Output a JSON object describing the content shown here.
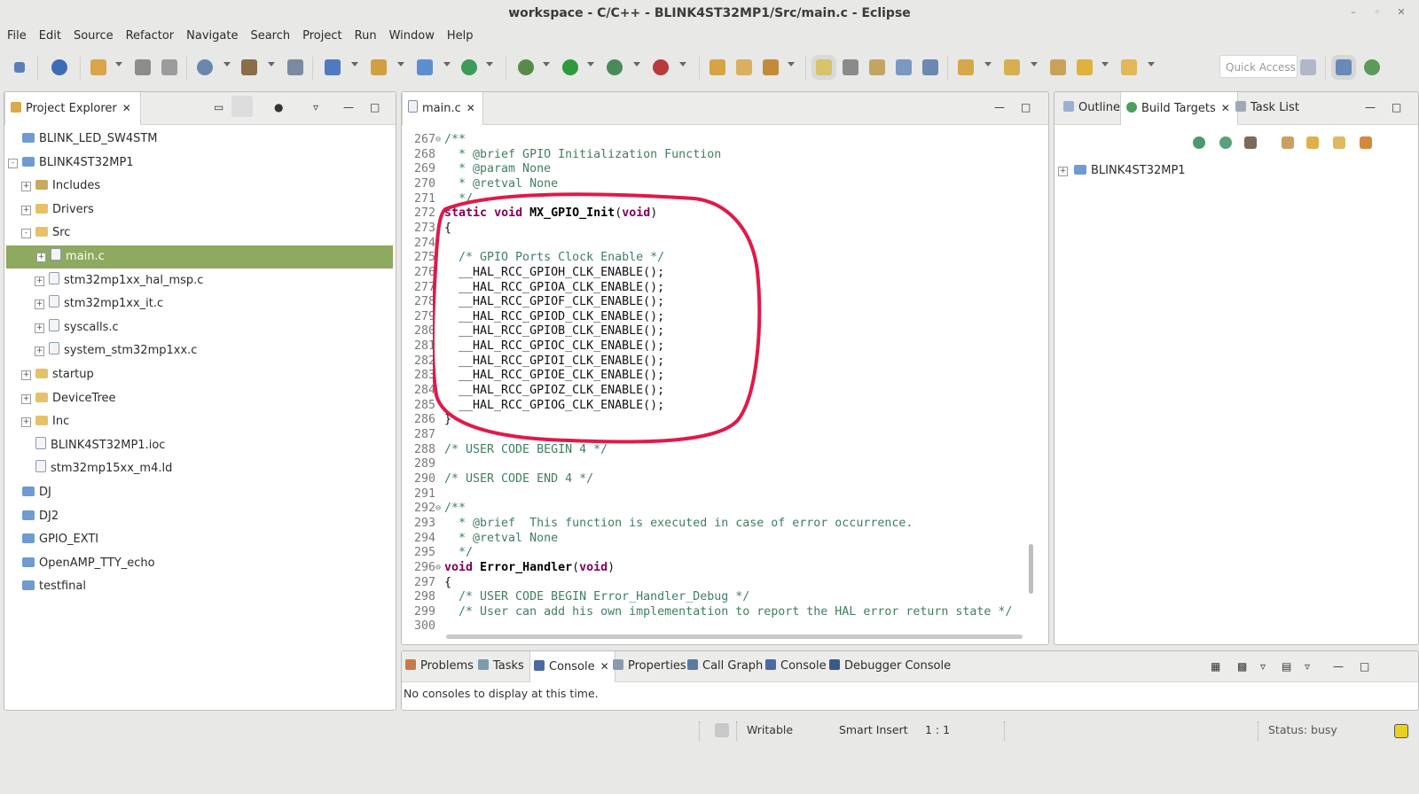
{
  "window": {
    "title": "workspace - C/C++ - BLINK4ST32MP1/Src/main.c - Eclipse"
  },
  "menu": [
    "File",
    "Edit",
    "Source",
    "Refactor",
    "Navigate",
    "Search",
    "Project",
    "Run",
    "Window",
    "Help"
  ],
  "toolbar": {
    "quick_access_placeholder": "Quick Access"
  },
  "project_explorer": {
    "tab": "Project Explorer",
    "items": [
      {
        "label": "BLINK_LED_SW4STM",
        "icon": "project-folder-icon"
      },
      {
        "label": "BLINK4ST32MP1",
        "icon": "project-folder-icon"
      },
      {
        "label": "Includes",
        "icon": "includes-icon"
      },
      {
        "label": "Drivers",
        "icon": "folder-icon"
      },
      {
        "label": "Src",
        "icon": "folder-icon"
      },
      {
        "label": "main.c",
        "icon": "c-file-icon"
      },
      {
        "label": "stm32mp1xx_hal_msp.c",
        "icon": "c-file-icon"
      },
      {
        "label": "stm32mp1xx_it.c",
        "icon": "c-file-icon"
      },
      {
        "label": "syscalls.c",
        "icon": "c-file-icon"
      },
      {
        "label": "system_stm32mp1xx.c",
        "icon": "c-file-icon"
      },
      {
        "label": "startup",
        "icon": "folder-icon"
      },
      {
        "label": "DeviceTree",
        "icon": "folder-icon"
      },
      {
        "label": "Inc",
        "icon": "folder-icon"
      },
      {
        "label": "BLINK4ST32MP1.ioc",
        "icon": "file-icon"
      },
      {
        "label": "stm32mp15xx_m4.ld",
        "icon": "file-icon"
      },
      {
        "label": "DJ",
        "icon": "project-folder-icon"
      },
      {
        "label": "DJ2",
        "icon": "project-folder-icon"
      },
      {
        "label": "GPIO_EXTI",
        "icon": "project-folder-icon"
      },
      {
        "label": "OpenAMP_TTY_echo",
        "icon": "project-folder-icon"
      },
      {
        "label": "testfinal",
        "icon": "project-folder-icon"
      }
    ]
  },
  "editor": {
    "tab": "main.c",
    "lines": [
      {
        "n": "267",
        "t": "/**"
      },
      {
        "n": "268",
        "t": "  * @brief GPIO Initialization Function"
      },
      {
        "n": "269",
        "t": "  * @param None"
      },
      {
        "n": "270",
        "t": "  * @retval None"
      },
      {
        "n": "271",
        "t": "  */"
      },
      {
        "n": "272",
        "t": "static void MX_GPIO_Init(void)"
      },
      {
        "n": "273",
        "t": "{"
      },
      {
        "n": "274",
        "t": ""
      },
      {
        "n": "275",
        "t": "  /* GPIO Ports Clock Enable */"
      },
      {
        "n": "276",
        "t": "  __HAL_RCC_GPIOH_CLK_ENABLE();"
      },
      {
        "n": "277",
        "t": "  __HAL_RCC_GPIOA_CLK_ENABLE();"
      },
      {
        "n": "278",
        "t": "  __HAL_RCC_GPIOF_CLK_ENABLE();"
      },
      {
        "n": "279",
        "t": "  __HAL_RCC_GPIOD_CLK_ENABLE();"
      },
      {
        "n": "280",
        "t": "  __HAL_RCC_GPIOB_CLK_ENABLE();"
      },
      {
        "n": "281",
        "t": "  __HAL_RCC_GPIOC_CLK_ENABLE();"
      },
      {
        "n": "282",
        "t": "  __HAL_RCC_GPIOI_CLK_ENABLE();"
      },
      {
        "n": "283",
        "t": "  __HAL_RCC_GPIOE_CLK_ENABLE();"
      },
      {
        "n": "284",
        "t": "  __HAL_RCC_GPIOZ_CLK_ENABLE();"
      },
      {
        "n": "285",
        "t": "  __HAL_RCC_GPIOG_CLK_ENABLE();"
      },
      {
        "n": "286",
        "t": "}"
      },
      {
        "n": "287",
        "t": ""
      },
      {
        "n": "288",
        "t": "/* USER CODE BEGIN 4 */"
      },
      {
        "n": "289",
        "t": ""
      },
      {
        "n": "290",
        "t": "/* USER CODE END 4 */"
      },
      {
        "n": "291",
        "t": ""
      },
      {
        "n": "292",
        "t": "/**"
      },
      {
        "n": "293",
        "t": "  * @brief  This function is executed in case of error occurrence."
      },
      {
        "n": "294",
        "t": "  * @retval None"
      },
      {
        "n": "295",
        "t": "  */"
      },
      {
        "n": "296",
        "t": "void Error_Handler(void)"
      },
      {
        "n": "297",
        "t": "{"
      },
      {
        "n": "298",
        "t": "  /* USER CODE BEGIN Error_Handler_Debug */"
      },
      {
        "n": "299",
        "t": "  /* User can add his own implementation to report the HAL error return state */"
      },
      {
        "n": "300",
        "t": ""
      }
    ]
  },
  "right_panel": {
    "tabs": [
      "Outline",
      "Build Targets",
      "Task List"
    ],
    "tree": [
      "BLINK4ST32MP1"
    ]
  },
  "bottom_panel": {
    "tabs": [
      "Problems",
      "Tasks",
      "Console",
      "Properties",
      "Call Graph",
      "Console",
      "Debugger Console"
    ],
    "message": "No consoles to display at this time."
  },
  "status": {
    "writable": "Writable",
    "insert_mode": "Smart Insert",
    "position": "1 : 1",
    "status": "Status: busy"
  },
  "colors": {
    "selection": "#8ea960",
    "annotation": "#e0194a",
    "keyword": "#7f0055",
    "comment": "#3f7f5f"
  }
}
